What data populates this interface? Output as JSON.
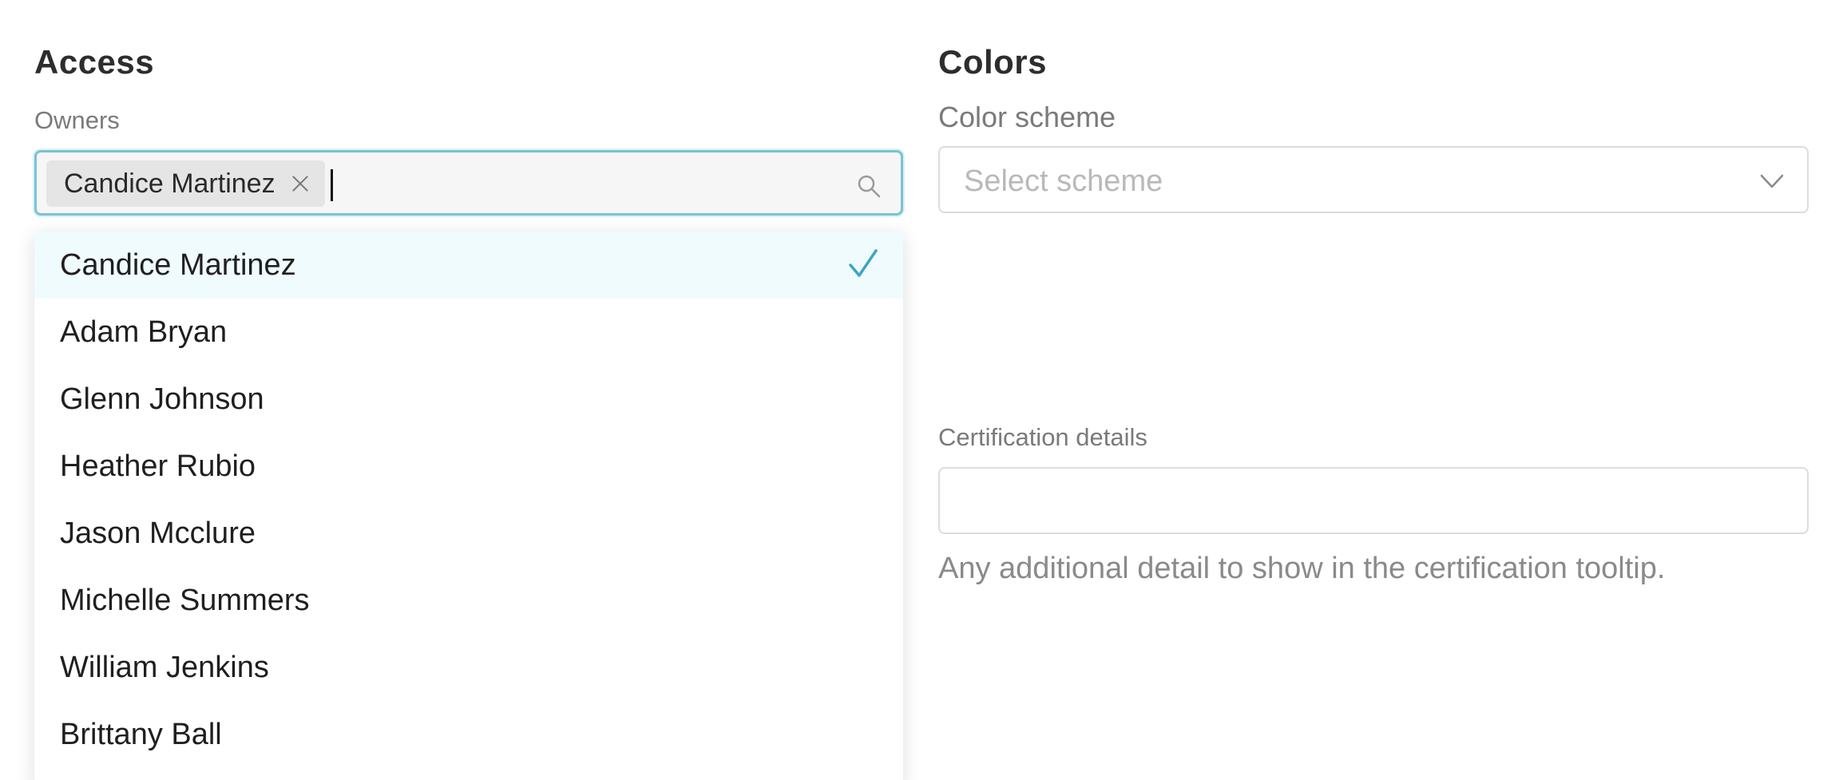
{
  "access": {
    "title": "Access",
    "owners_label": "Owners",
    "selected_tags": [
      "Candice Martinez"
    ],
    "search_icon": "search-icon",
    "options": [
      {
        "label": "Candice Martinez",
        "selected": true
      },
      {
        "label": "Adam Bryan",
        "selected": false
      },
      {
        "label": "Glenn Johnson",
        "selected": false
      },
      {
        "label": "Heather Rubio",
        "selected": false
      },
      {
        "label": "Jason Mcclure",
        "selected": false
      },
      {
        "label": "Michelle Summers",
        "selected": false
      },
      {
        "label": "William Jenkins",
        "selected": false
      },
      {
        "label": "Brittany Ball",
        "selected": false
      }
    ]
  },
  "colors": {
    "title": "Colors",
    "scheme_label": "Color scheme",
    "scheme_placeholder": "Select scheme",
    "certification_label": "Certification details",
    "certification_value": "",
    "certification_help": "Any additional detail to show in the certification tooltip."
  },
  "theme": {
    "accent": "#3aa8c1",
    "focus_border": "#78c3d6",
    "selected_row_bg": "#f0fbfd"
  }
}
